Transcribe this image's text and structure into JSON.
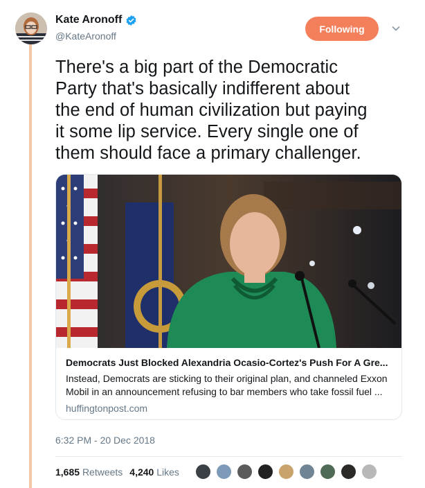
{
  "author": {
    "name": "Kate Aronoff",
    "handle": "@KateAronoff",
    "verified": true
  },
  "follow_button": {
    "label": "Following"
  },
  "tweet": {
    "text": "There's a big part of the Democratic\nParty that's basically indifferent about\nthe end of human civilization but paying\nit some lip service. Every single one of\nthem should face a primary challenger."
  },
  "card": {
    "title": "Democrats Just Blocked Alexandria Ocasio-Cortez's Push For A Gre...",
    "description": "Instead, Democrats are sticking to their original plan, and channeled Exxon Mobil in an announcement refusing to bar members who take fossil fuel ...",
    "domain": "huffingtonpost.com"
  },
  "timestamp": "6:32 PM - 20 Dec 2018",
  "stats": {
    "retweets_count": "1,685",
    "retweets_label": "Retweets",
    "likes_count": "4,240",
    "likes_label": "Likes"
  },
  "colors": {
    "accent": "#f4805b",
    "thread_line": "#f6c6a8",
    "verified": "#1da1f2",
    "secondary_text": "#657786"
  },
  "likers": [
    {
      "color": "#3b3f46"
    },
    {
      "color": "#7d9bb8"
    },
    {
      "color": "#5b5b5b"
    },
    {
      "color": "#222222"
    },
    {
      "color": "#c9a36b"
    },
    {
      "color": "#6f8494"
    },
    {
      "color": "#4f6b55"
    },
    {
      "color": "#2c2a27"
    },
    {
      "color": "#b8b8b8"
    }
  ]
}
